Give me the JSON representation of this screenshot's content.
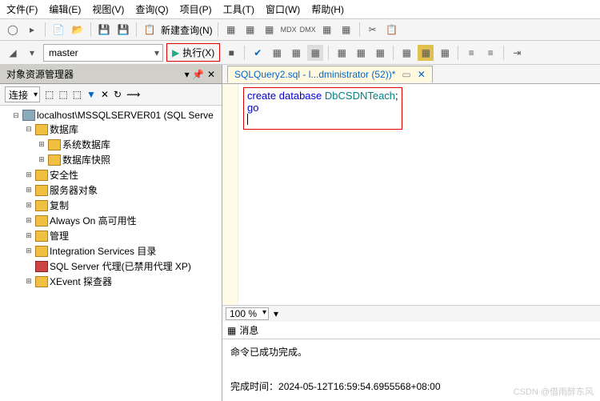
{
  "menu": {
    "file": "文件(F)",
    "edit": "编辑(E)",
    "view": "视图(V)",
    "query": "查询(Q)",
    "project": "项目(P)",
    "tools": "工具(T)",
    "window": "窗口(W)",
    "help": "帮助(H)"
  },
  "toolbar1": {
    "new_query": "新建查询(N)"
  },
  "toolbar2": {
    "db_selector": "master",
    "execute": "执行(X)"
  },
  "sidebar": {
    "panel_title": "对象资源管理器",
    "connect_label": "连接",
    "tree": {
      "root": "localhost\\MSSQLSERVER01 (SQL Serve",
      "databases": "数据库",
      "sys_db": "系统数据库",
      "db_snapshot": "数据库快照",
      "security": "安全性",
      "server_objects": "服务器对象",
      "replication": "复制",
      "always_on": "Always On 高可用性",
      "management": "管理",
      "integration": "Integration Services 目录",
      "agent": "SQL Server 代理(已禁用代理 XP)",
      "xevent": "XEvent 探查器"
    }
  },
  "editor": {
    "tab_title": "SQLQuery2.sql - l...dministrator (52))*",
    "code_line1_kw1": "create",
    "code_line1_kw2": "database",
    "code_line1_ident": "DbCSDNTeach",
    "code_line1_end": ";",
    "code_line2": "go",
    "zoom": "100 %",
    "msg_tab": "消息",
    "msg_success": "命令已成功完成。",
    "msg_time_label": "完成时间：",
    "msg_time_value": "2024-05-12T16:59:54.6955568+08:00"
  },
  "watermark": "CSDN @借雨醉东风"
}
